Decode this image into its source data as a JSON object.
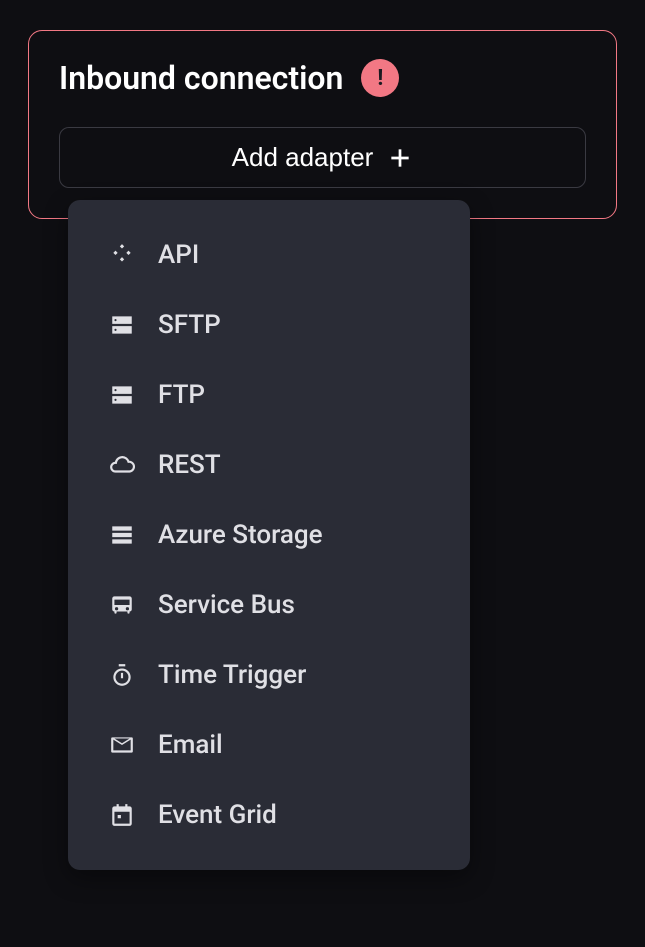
{
  "card": {
    "title": "Inbound connection",
    "alert_symbol": "!"
  },
  "button": {
    "label": "Add adapter"
  },
  "menu": {
    "items": [
      {
        "icon": "api-icon",
        "label": "API"
      },
      {
        "icon": "storage-icon",
        "label": "SFTP"
      },
      {
        "icon": "storage-icon",
        "label": "FTP"
      },
      {
        "icon": "cloud-icon",
        "label": "REST"
      },
      {
        "icon": "server-icon",
        "label": "Azure Storage"
      },
      {
        "icon": "bus-icon",
        "label": "Service Bus"
      },
      {
        "icon": "timer-icon",
        "label": "Time Trigger"
      },
      {
        "icon": "email-icon",
        "label": "Email"
      },
      {
        "icon": "calendar-icon",
        "label": "Event Grid"
      }
    ]
  }
}
